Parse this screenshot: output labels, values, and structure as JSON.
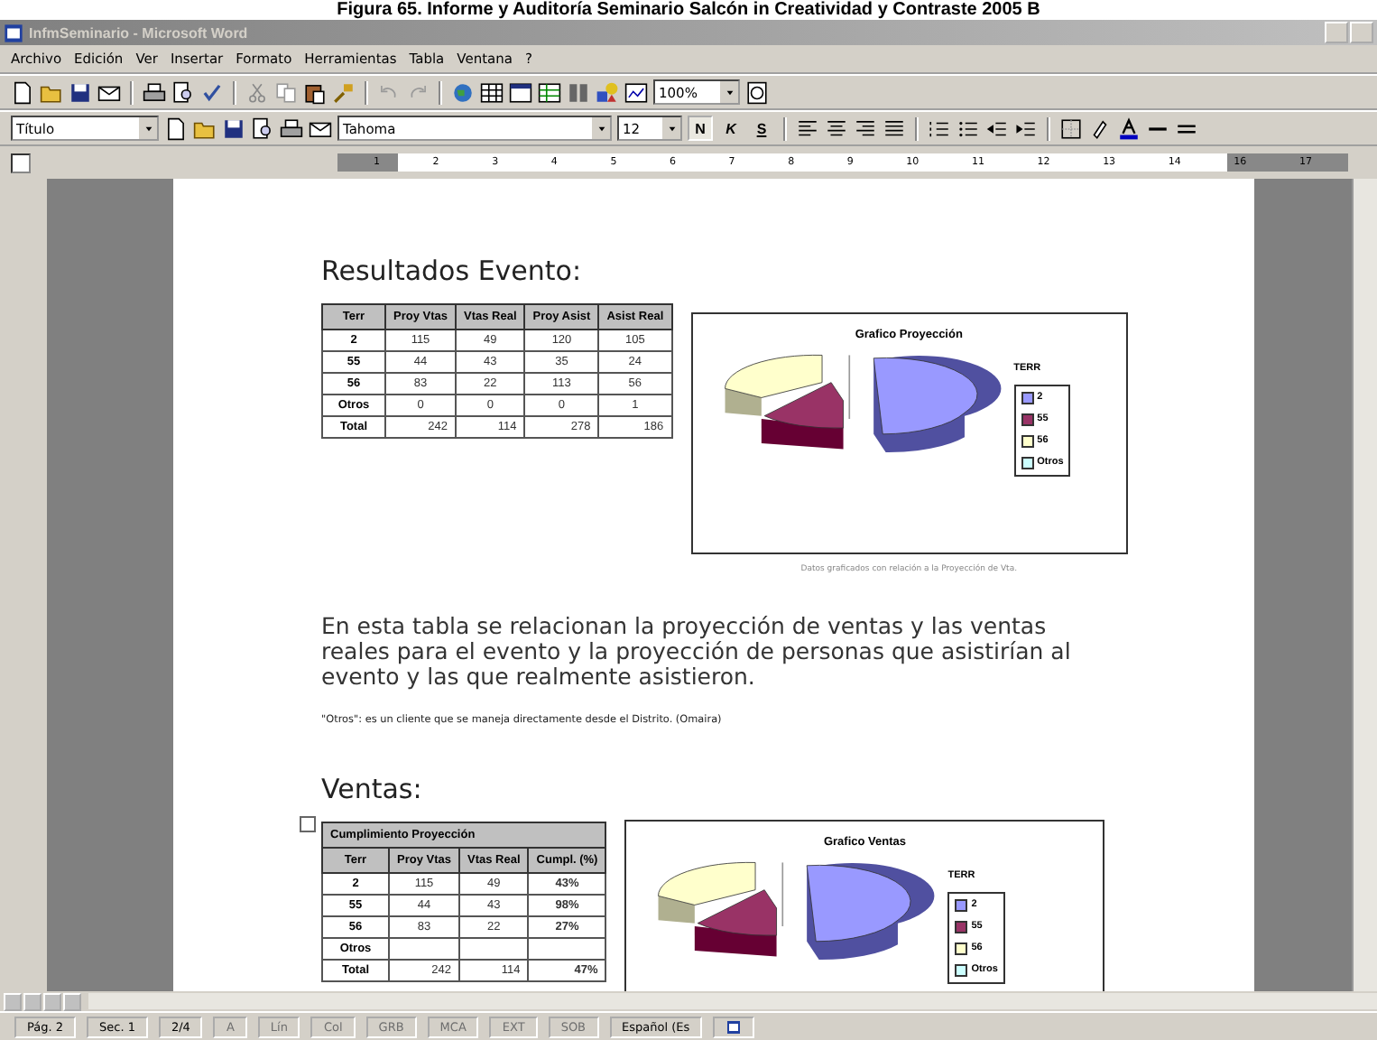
{
  "caption": "Figura 65. Informe y Auditoría Seminario Salcón in Creatividad y Contraste 2005 B",
  "window": {
    "title": "InfmSeminario - Microsoft Word"
  },
  "menu": [
    "Archivo",
    "Edición",
    "Ver",
    "Insertar",
    "Formato",
    "Herramientas",
    "Tabla",
    "Ventana",
    "?"
  ],
  "toolbar": {
    "zoom": "100%",
    "style": "Título",
    "font": "Tahoma",
    "size": "12",
    "format_buttons": [
      "N",
      "K",
      "S"
    ]
  },
  "ruler": {
    "labels": [
      "1",
      "2",
      "3",
      "4",
      "5",
      "6",
      "7",
      "8",
      "9",
      "10",
      "11",
      "12",
      "13",
      "14",
      "16",
      "17"
    ]
  },
  "document": {
    "heading": "Resultados Evento:",
    "table": {
      "columns": [
        "Terr",
        "Proy Vtas",
        "Vtas Real",
        "Proy Asist",
        "Asist Real"
      ],
      "rows": [
        [
          "2",
          "115",
          "49",
          "120",
          "105"
        ],
        [
          "55",
          "44",
          "43",
          "35",
          "24"
        ],
        [
          "56",
          "83",
          "22",
          "113",
          "56"
        ],
        [
          "Otros",
          "0",
          "0",
          "0",
          "1"
        ],
        [
          "Total",
          "242",
          "114",
          "278",
          "186"
        ]
      ]
    },
    "chart": {
      "title": "Grafico Proyección",
      "legend_title": "TERR",
      "legend": [
        {
          "label": "2",
          "color": "#9999ff"
        },
        {
          "label": "55",
          "color": "#993366"
        },
        {
          "label": "56",
          "color": "#ffffcc"
        },
        {
          "label": "Otros",
          "color": "#ccffff"
        }
      ],
      "note": "Datos graficados con relación a la Proyección de Vta."
    },
    "paragraph": "En esta tabla se relacionan la proyección de ventas y las ventas reales para el evento y la proyección de personas que asistirían al evento y las que realmente asistieron.",
    "footnote": "\"Otros\": es un cliente que se maneja directamente desde el Distrito. (Omaira)",
    "heading2": "Ventas:",
    "table2": {
      "title": "Cumplimiento Proyección",
      "columns": [
        "Terr",
        "Proy Vtas",
        "Vtas Real",
        "Cumpl. (%)"
      ],
      "rows": [
        [
          "2",
          "115",
          "49",
          "43%"
        ],
        [
          "55",
          "44",
          "43",
          "98%"
        ],
        [
          "56",
          "83",
          "22",
          "27%"
        ],
        [
          "Otros",
          "",
          "",
          ""
        ],
        [
          "Total",
          "242",
          "114",
          "47%"
        ]
      ]
    },
    "chart2": {
      "title": "Grafico Ventas",
      "legend_title": "TERR",
      "legend": [
        {
          "label": "2",
          "color": "#9999ff"
        },
        {
          "label": "55",
          "color": "#993366"
        },
        {
          "label": "56",
          "color": "#ffffcc"
        },
        {
          "label": "Otros",
          "color": "#ccffff"
        }
      ]
    }
  },
  "status_bar": [
    {
      "text": "Pág. 2",
      "disabled": false
    },
    {
      "text": "Sec. 1",
      "disabled": false
    },
    {
      "text": "2/4",
      "disabled": false
    },
    {
      "text": "A",
      "disabled": true
    },
    {
      "text": "Lín",
      "disabled": true
    },
    {
      "text": "Col",
      "disabled": true
    },
    {
      "text": "GRB",
      "disabled": true
    },
    {
      "text": "MCA",
      "disabled": true
    },
    {
      "text": "EXT",
      "disabled": true
    },
    {
      "text": "SOB",
      "disabled": true
    },
    {
      "text": "Español (Es",
      "disabled": false
    }
  ]
}
